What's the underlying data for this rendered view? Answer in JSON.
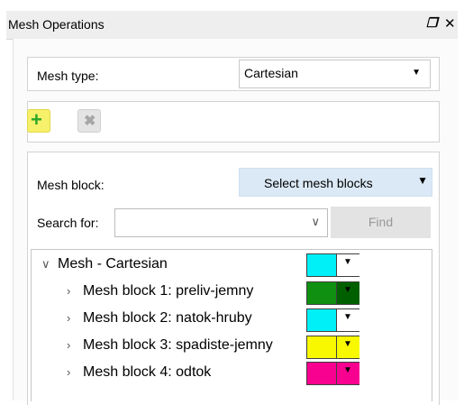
{
  "window": {
    "title": "Mesh Operations",
    "float_icon": "restore-icon",
    "close_icon": "close-icon"
  },
  "mesh_type": {
    "label": "Mesh type:",
    "value": "Cartesian"
  },
  "toolbar": {
    "add_icon": "add-icon",
    "remove_icon": "remove-icon",
    "add_color": "#2aa62a",
    "remove_color": "#a6a6a6"
  },
  "mesh_block": {
    "label": "Mesh block:",
    "select_label": "Select  mesh blocks"
  },
  "search": {
    "label": "Search for:",
    "value": "",
    "find_label": "Find"
  },
  "tree": {
    "root": {
      "label": "Mesh - Cartesian",
      "color": "#00f0f8",
      "dd_bg": "#ffffff"
    },
    "items": [
      {
        "label": "Mesh block 1: preliv-jemny",
        "color": "#109010",
        "dd_bg": "#006000"
      },
      {
        "label": "Mesh block 2: natok-hruby",
        "color": "#00f0f8",
        "dd_bg": "#ffffff"
      },
      {
        "label": "Mesh block 3: spadiste-jemny",
        "color": "#f8f800",
        "dd_bg": "#f8f800"
      },
      {
        "label": "Mesh block 4: odtok",
        "color": "#f80090",
        "dd_bg": "#f80090"
      }
    ]
  }
}
